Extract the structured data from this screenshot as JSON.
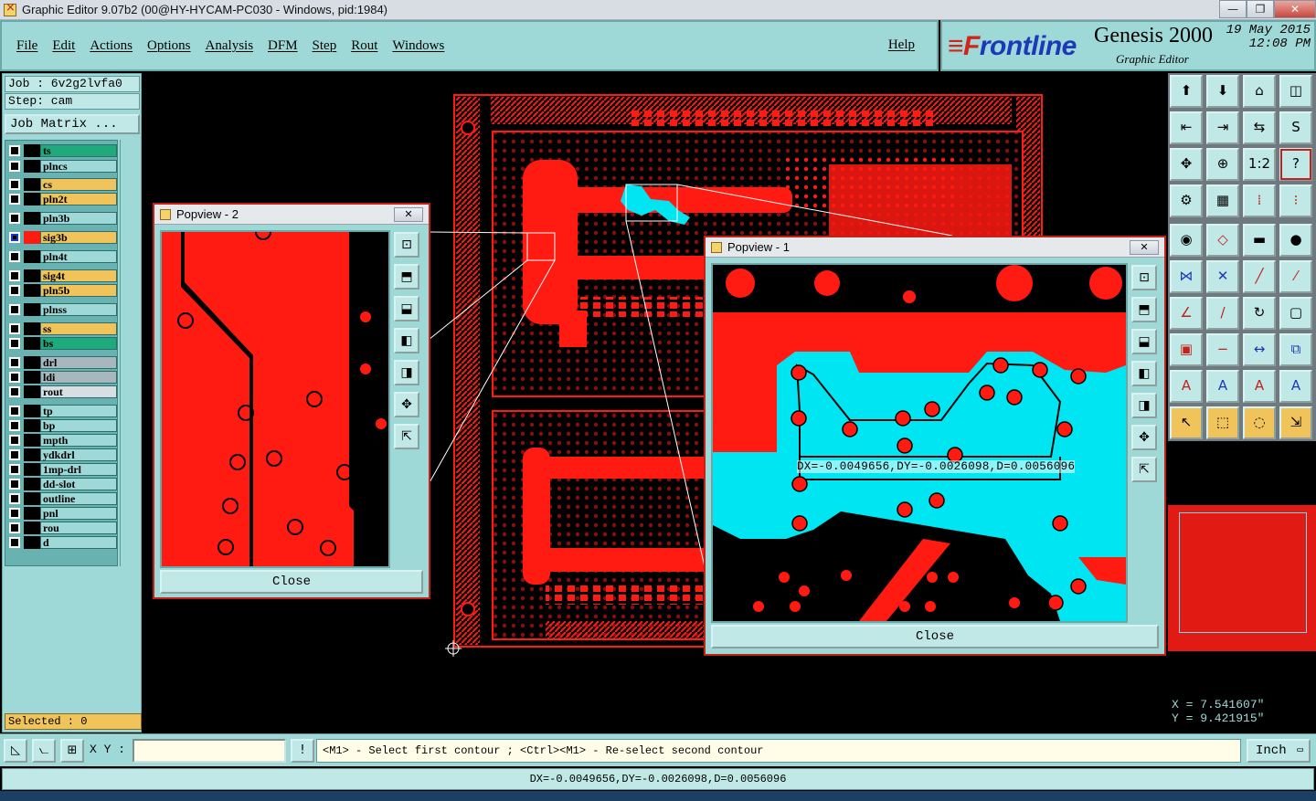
{
  "window": {
    "title": "Graphic Editor 9.07b2 (00@HY-HYCAM-PC030 - Windows, pid:1984)",
    "minimize": "—",
    "restore": "❐",
    "close": "✕"
  },
  "menu": {
    "items": [
      "File",
      "Edit",
      "Actions",
      "Options",
      "Analysis",
      "DFM",
      "Step",
      "Rout",
      "Windows"
    ],
    "help": "Help"
  },
  "brand": {
    "logo_f": "≡F",
    "logo_rest": "rontline",
    "product": "Genesis 2000",
    "subtitle": "Graphic Editor",
    "date": "19 May 2015",
    "time": "12:08 PM"
  },
  "left": {
    "job": "Job : 6v2g2lvfa0",
    "step": "Step: cam",
    "job_matrix": "Job Matrix ...",
    "selected": "Selected : 0",
    "layers": [
      {
        "name": "ts",
        "color": "#1faa7c",
        "active": false
      },
      {
        "name": "plncs",
        "color": "#9fd9d7",
        "active": false
      },
      {
        "name": "cs",
        "color": "#f0c45a",
        "active": false
      },
      {
        "name": "pln2t",
        "color": "#f0c45a",
        "active": false
      },
      {
        "name": "pln3b",
        "color": "#9fd9d7",
        "active": false
      },
      {
        "name": "sig3b",
        "color": "#f0c45a",
        "active": true
      },
      {
        "name": "pln4t",
        "color": "#9fd9d7",
        "active": false
      },
      {
        "name": "sig4t",
        "color": "#f0c45a",
        "active": false
      },
      {
        "name": "pln5b",
        "color": "#f0c45a",
        "active": false
      },
      {
        "name": "plnss",
        "color": "#9fd9d7",
        "active": false
      },
      {
        "name": "ss",
        "color": "#f0c45a",
        "active": false
      },
      {
        "name": "bs",
        "color": "#1faa7c",
        "active": false
      },
      {
        "name": "drl",
        "color": "#a8b6bd",
        "active": false
      },
      {
        "name": "ldi",
        "color": "#a8b6bd",
        "active": false
      },
      {
        "name": "rout",
        "color": "#d8dee2",
        "active": false
      },
      {
        "name": "tp",
        "color": "#9fd9d7",
        "active": false
      },
      {
        "name": "bp",
        "color": "#9fd9d7",
        "active": false
      },
      {
        "name": "mpth",
        "color": "#9fd9d7",
        "active": false
      },
      {
        "name": "ydkdrl",
        "color": "#9fd9d7",
        "active": false
      },
      {
        "name": "1mp-drl",
        "color": "#9fd9d7",
        "active": false
      },
      {
        "name": "dd-slot",
        "color": "#9fd9d7",
        "active": false
      },
      {
        "name": "outline",
        "color": "#9fd9d7",
        "active": false
      },
      {
        "name": "pnl",
        "color": "#9fd9d7",
        "active": false
      },
      {
        "name": "rou",
        "color": "#9fd9d7",
        "active": false
      },
      {
        "name": "d",
        "color": "#9fd9d7",
        "active": false
      }
    ]
  },
  "popview2": {
    "title": "Popview - 2",
    "close_x": "✕",
    "close_label": "Close"
  },
  "popview1": {
    "title": "Popview - 1",
    "close_x": "✕",
    "close_label": "Close",
    "measurement": "DX=-0.0049656,DY=-0.0026098,D=0.0056096"
  },
  "coords": {
    "x": "X = 7.541607\"",
    "y": "Y = 9.421915\""
  },
  "cmd": {
    "xy_label": "X Y :",
    "xy_value": "",
    "prompt": "<M1> - Select first contour ; <Ctrl><M1> - Re-select second contour",
    "unit": "Inch",
    "warn": "!"
  },
  "status": "DX=-0.0049656,DY=-0.0026098,D=0.0056096",
  "colors": {
    "accent": "#9fd9d7",
    "copper": "#ff1a12",
    "highlight": "#00e5f2"
  }
}
